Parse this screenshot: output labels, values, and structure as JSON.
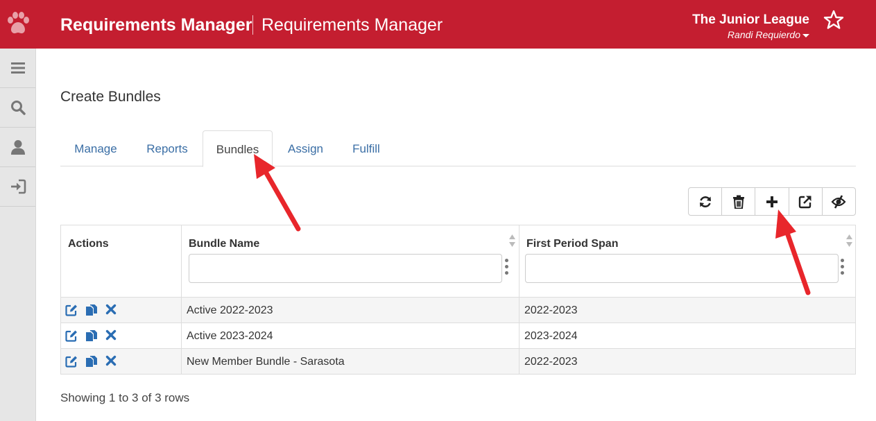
{
  "header": {
    "app_title": "Requirements Manager",
    "app_subtitle": "Requirements Manager",
    "org_name": "The Junior League",
    "user_name": "Randi Requierdo",
    "brand_color": "#c41e30"
  },
  "sidebar": {
    "items": [
      {
        "icon": "menu-icon"
      },
      {
        "icon": "search-icon"
      },
      {
        "icon": "user-icon"
      },
      {
        "icon": "sign-in-icon"
      }
    ]
  },
  "page": {
    "title": "Create Bundles"
  },
  "tabs": [
    {
      "label": "Manage"
    },
    {
      "label": "Reports"
    },
    {
      "label": "Bundles",
      "active": true
    },
    {
      "label": "Assign"
    },
    {
      "label": "Fulfill"
    }
  ],
  "toolbar": {
    "buttons": [
      "refresh-icon",
      "trash-icon",
      "plus-icon",
      "external-link-icon",
      "eye-slash-icon"
    ]
  },
  "table": {
    "columns": [
      "Actions",
      "Bundle Name",
      "First Period Span"
    ],
    "rows": [
      {
        "bundle_name": "Active 2022-2023",
        "period": "2022-2023"
      },
      {
        "bundle_name": "Active 2023-2024",
        "period": "2023-2024"
      },
      {
        "bundle_name": "New Member Bundle - Sarasota",
        "period": "2022-2023"
      }
    ],
    "row_action_icons": [
      "edit-icon",
      "copy-icon",
      "delete-icon"
    ]
  },
  "footer": {
    "pagination_text": "Showing 1 to 3 of 3 rows"
  },
  "annotation_color": "#e8262b"
}
